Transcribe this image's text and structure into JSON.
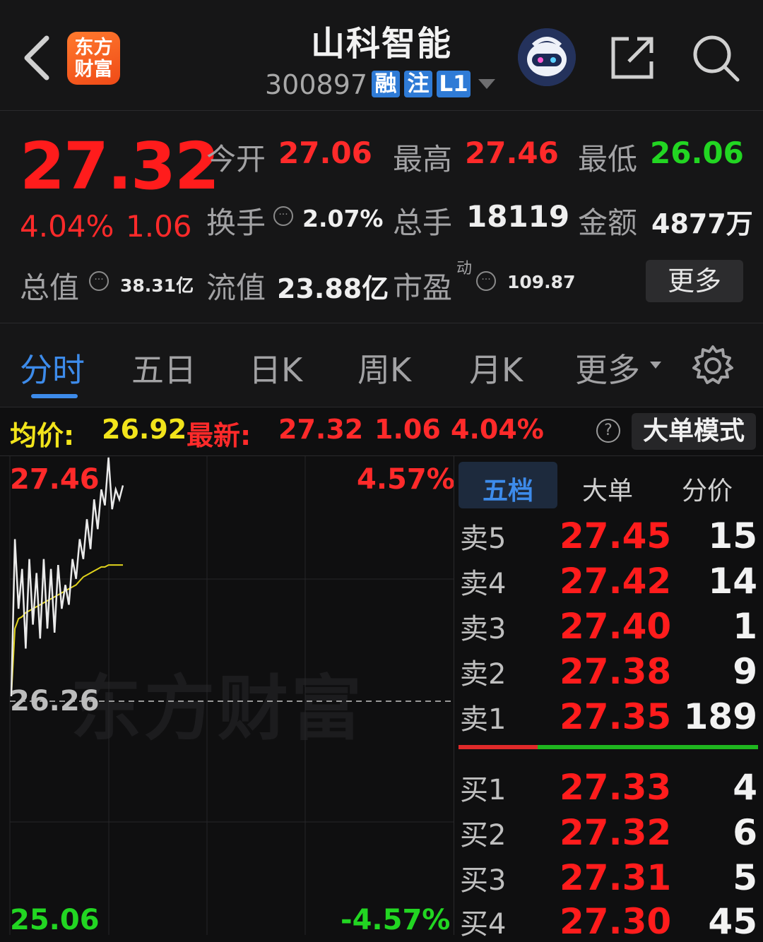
{
  "header": {
    "logo_line1": "东方",
    "logo_line2": "财富",
    "title": "山科智能",
    "code": "300897",
    "tags": [
      "融",
      "注",
      "L1"
    ]
  },
  "quote": {
    "price": "27.32",
    "change_pct": "4.04%",
    "change_amt": "1.06",
    "open_label": "今开",
    "open": "27.06",
    "high_label": "最高",
    "high": "27.46",
    "low_label": "最低",
    "low": "26.06",
    "turnover_label": "换手",
    "turnover": "2.07%",
    "volume_label": "总手",
    "volume": "18119",
    "amount_label": "金额",
    "amount": "4877万",
    "mktcap_label": "总值",
    "mktcap": "38.31亿",
    "float_label": "流值",
    "float_cap": "23.88亿",
    "pe_label": "市盈",
    "pe_sup": "动",
    "pe": "109.87",
    "more_button": "更多"
  },
  "tabs": [
    "分时",
    "五日",
    "日K",
    "周K",
    "月K",
    "更多"
  ],
  "avg_bar": {
    "avg_label": "均价:",
    "avg": "26.92",
    "latest_label": "最新:",
    "latest": "27.32",
    "change": "1.06",
    "change_pct": "4.04%",
    "help": "?",
    "mode_button": "大单模式"
  },
  "chart": {
    "top_price": "27.46",
    "top_pct": "4.57%",
    "mid_price": "26.26",
    "bottom_price": "25.06",
    "bottom_pct": "-4.57%",
    "watermark": "东方财富"
  },
  "chart_data": {
    "type": "line",
    "ylim": [
      25.06,
      27.46
    ],
    "prev_close": 26.26,
    "series": [
      {
        "values": [
          26.26,
          27.05,
          26.7,
          26.9,
          26.5,
          26.95,
          26.62,
          26.88,
          26.55,
          26.95,
          26.6,
          26.9,
          26.58,
          26.92,
          26.7,
          26.82,
          26.72,
          26.95,
          26.85,
          27.05,
          26.95,
          27.15,
          27.0,
          27.25,
          27.1,
          27.3,
          27.22,
          27.46,
          27.2,
          27.3,
          27.25,
          27.32
        ]
      },
      {
        "values": [
          26.26,
          26.6,
          26.65,
          26.66,
          26.68,
          26.69,
          26.7,
          26.71,
          26.72,
          26.73,
          26.74,
          26.75,
          26.76,
          26.77,
          26.78,
          26.79,
          26.8,
          26.81,
          26.82,
          26.84,
          26.86,
          26.87,
          26.88,
          26.89,
          26.9,
          26.91,
          26.91,
          26.92,
          26.92,
          26.92,
          26.92,
          26.92
        ]
      }
    ]
  },
  "order_book": {
    "tabs": [
      "五档",
      "大单",
      "分价"
    ],
    "asks": [
      {
        "label": "卖5",
        "price": "27.45",
        "volume": "15"
      },
      {
        "label": "卖4",
        "price": "27.42",
        "volume": "14"
      },
      {
        "label": "卖3",
        "price": "27.40",
        "volume": "1"
      },
      {
        "label": "卖2",
        "price": "27.38",
        "volume": "9"
      },
      {
        "label": "卖1",
        "price": "27.35",
        "volume": "189"
      }
    ],
    "bids": [
      {
        "label": "买1",
        "price": "27.33",
        "volume": "4"
      },
      {
        "label": "买2",
        "price": "27.32",
        "volume": "6"
      },
      {
        "label": "买3",
        "price": "27.31",
        "volume": "5"
      },
      {
        "label": "买4",
        "price": "27.30",
        "volume": "45"
      }
    ]
  }
}
